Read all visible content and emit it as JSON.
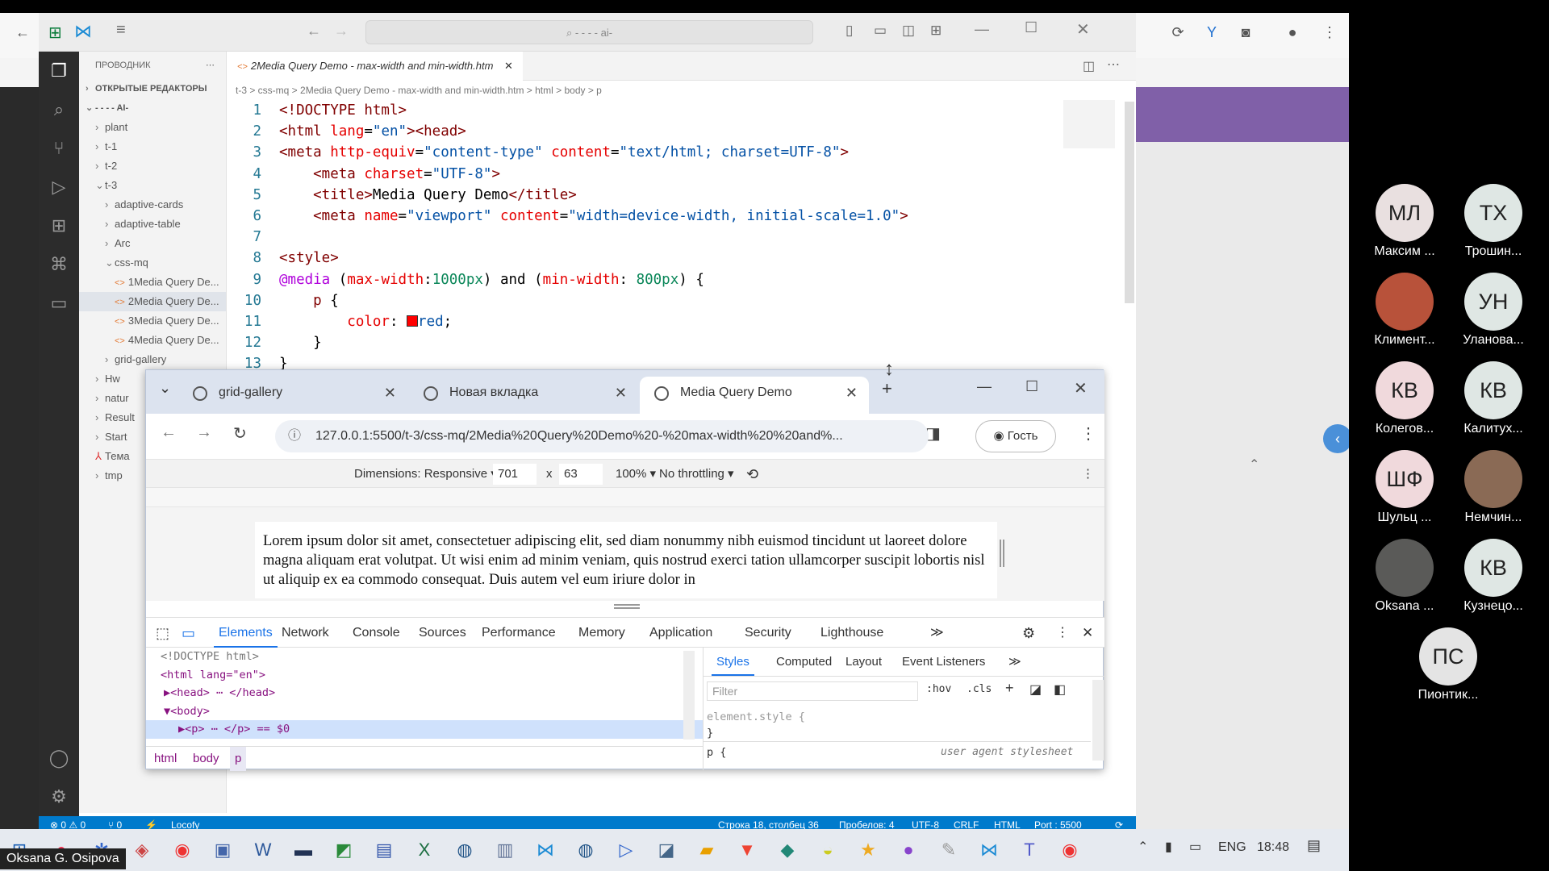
{
  "vscode": {
    "search_placeholder": "- - - - ai-",
    "explorer_title": "ПРОВОДНИК",
    "open_editors": "ОТКРЫТЫЕ РЕДАКТОРЫ",
    "root_folder": "- - - - AI-",
    "tree": [
      "plant",
      "t-1",
      "t-2",
      "t-3",
      "adaptive-cards",
      "adaptive-table",
      "Arc",
      "css-mq",
      "1Media Query De...",
      "2Media Query De...",
      "3Media Query De...",
      "4Media Query De...",
      "grid-gallery",
      "Hw",
      "natur",
      "Result",
      "Start",
      "Тема",
      "tmp"
    ],
    "active_tab": "2Media Query Demo - max-width  and min-width.htm",
    "breadcrumb": "t-3 > css-mq > 2Media Query Demo - max-width  and min-width.htm > html > body > p",
    "code_lines": [
      "1",
      "2",
      "3",
      "4",
      "5",
      "6",
      "7",
      "8",
      "9",
      "10",
      "11",
      "12",
      "13"
    ],
    "status": {
      "errors": "⊗ 0 ⚠ 0",
      "ports": "⑂ 0",
      "locofy": "Locofy",
      "position": "Строка 18, столбец 36",
      "spaces": "Пробелов: 4",
      "encoding": "UTF-8",
      "eol": "CRLF",
      "lang": "HTML",
      "port": "Port : 5500"
    }
  },
  "chrome": {
    "tabs": [
      "grid-gallery",
      "Новая вкладка",
      "Media Query Demo"
    ],
    "url": "127.0.0.1:5500/t-3/css-mq/2Media%20Query%20Demo%20-%20max-width%20%20and%...",
    "profile": "Гость",
    "device": {
      "dimensions": "Dimensions: Responsive ▾",
      "width": "701",
      "x": "x",
      "height": "63",
      "zoom": "100% ▾",
      "throttle": "No throttling ▾"
    },
    "page_text": "Lorem ipsum dolor sit amet, consectetuer adipiscing elit, sed diam nonummy nibh euismod tincidunt ut laoreet dolore magna aliquam erat volutpat. Ut wisi enim ad minim veniam, quis nostrud exerci tation ullamcorper suscipit lobortis nisl ut aliquip ex ea commodo consequat. Duis autem vel eum iriure dolor in",
    "devtools_tabs": [
      "Elements",
      "Network",
      "Console",
      "Sources",
      "Performance",
      "Memory",
      "Application",
      "Security",
      "Lighthouse"
    ],
    "more_tabs": "≫",
    "dom": [
      "<!DOCTYPE html>",
      "<html lang=\"en\">",
      "▶<head> ⋯ </head>",
      "▼<body>",
      "▶<p> ⋯ </p> == $0"
    ],
    "styles_tabs": [
      "Styles",
      "Computed",
      "Layout",
      "Event Listeners"
    ],
    "filter_placeholder": "Filter",
    "hov": ":hov",
    "cls": ".cls",
    "element_style": "element.style {",
    "close_brace": "}",
    "p_rule": "p {",
    "ua": "user agent stylesheet",
    "crumbs": [
      "html",
      "body",
      "p"
    ]
  },
  "taskbar": {
    "lang": "ENG",
    "time": "18:48"
  },
  "participants": [
    {
      "initials": "МЛ",
      "name": "Максим ...",
      "color": "#e9e0e0"
    },
    {
      "initials": "ТХ",
      "name": "Трошин...",
      "color": "#dfe7e4"
    },
    {
      "initials": "",
      "name": "Климент...",
      "color": "#b8523a"
    },
    {
      "initials": "УН",
      "name": "Уланова...",
      "color": "#dfe7e4"
    },
    {
      "initials": "КВ",
      "name": "Колегов...",
      "color": "#f0d9dc"
    },
    {
      "initials": "КВ",
      "name": "Калитух...",
      "color": "#dfe7e4"
    },
    {
      "initials": "ШФ",
      "name": "Шульц ...",
      "color": "#f0d9dc"
    },
    {
      "initials": "",
      "name": "Немчин...",
      "color": "#8a6a55"
    },
    {
      "initials": "",
      "name": "Oksana ...",
      "color": "#5a5a58"
    },
    {
      "initials": "КВ",
      "name": "Кузнецо...",
      "color": "#dfe7e4"
    },
    {
      "initials": "ПС",
      "name": "Пионтик...",
      "color": "#e4e4e4"
    }
  ],
  "caption": "Oksana G. Osipova"
}
